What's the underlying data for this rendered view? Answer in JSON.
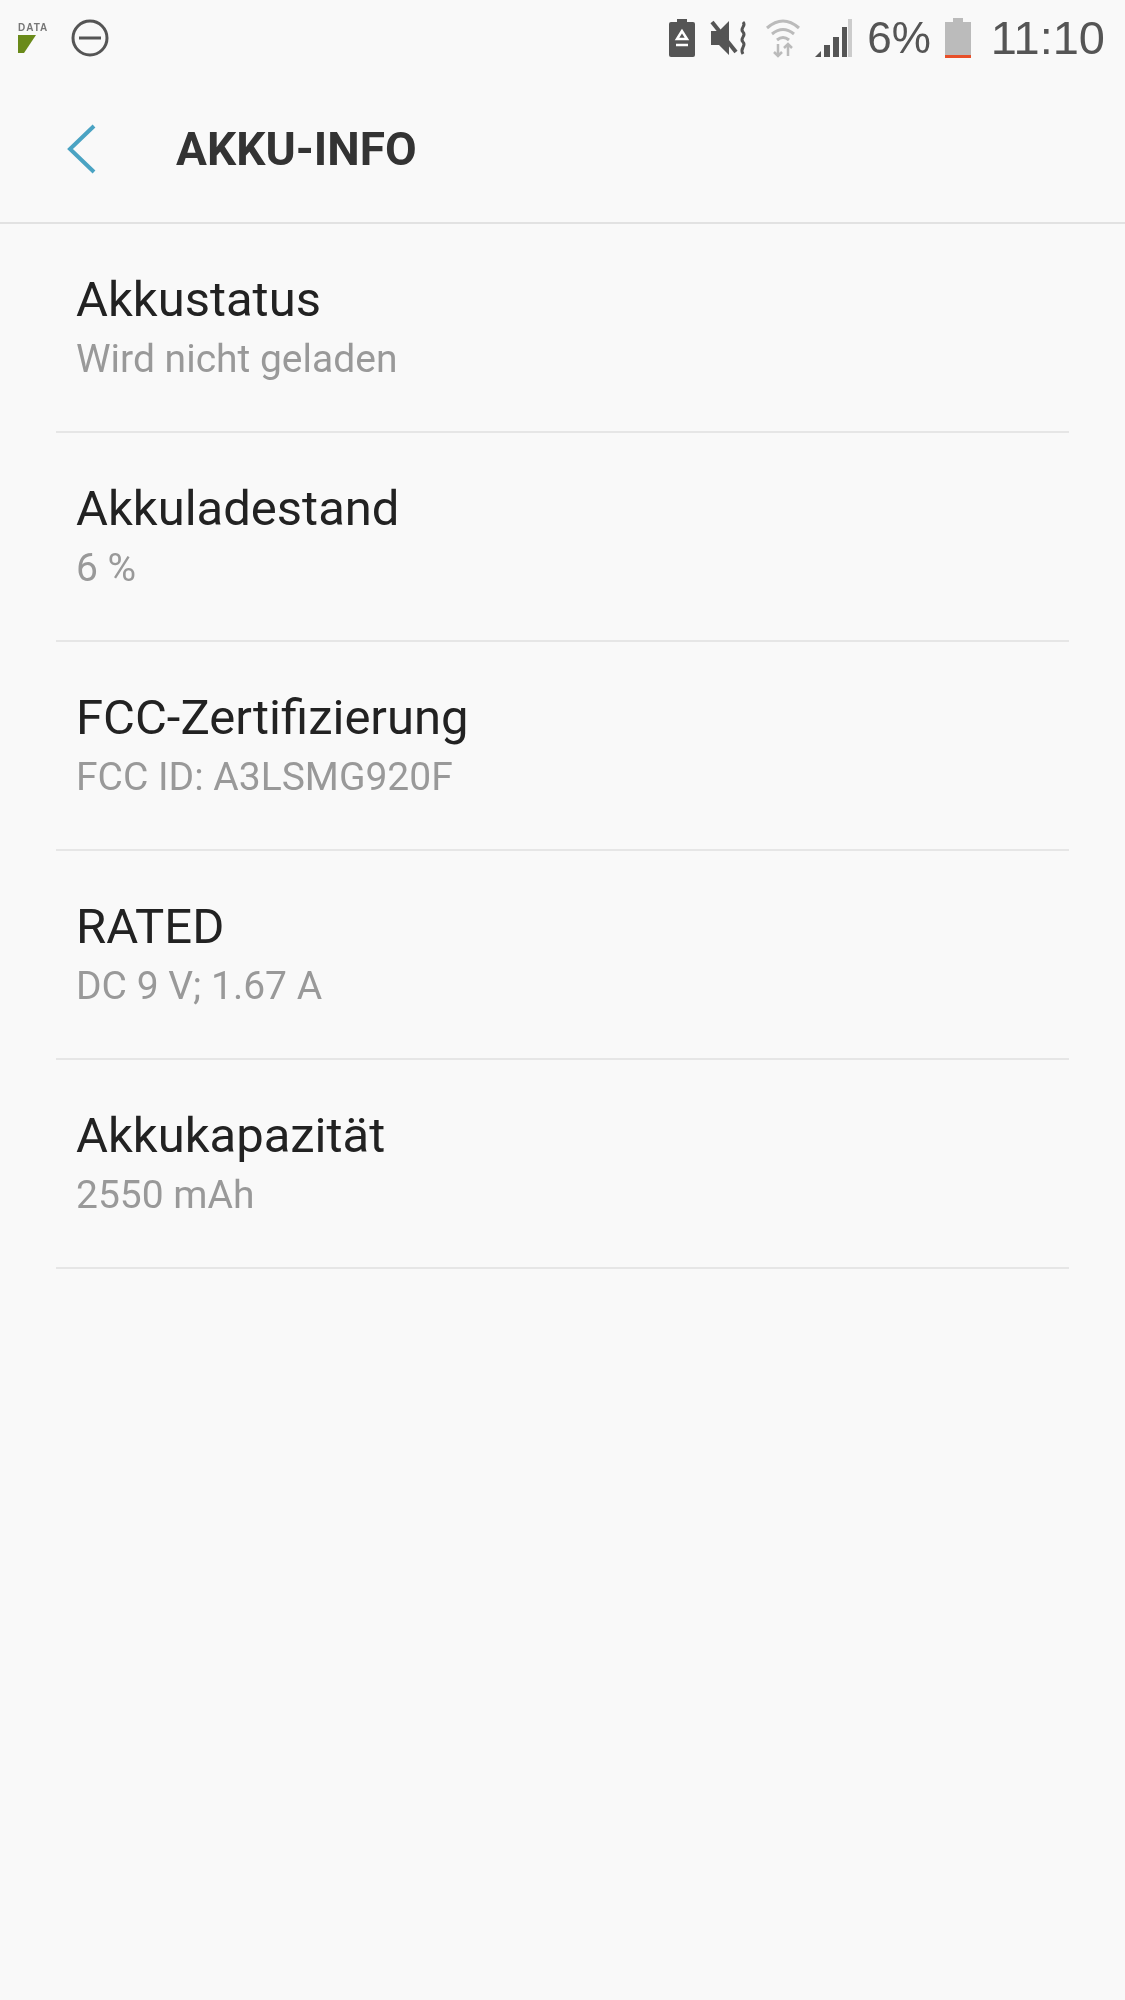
{
  "status_bar": {
    "data_label": "DATA",
    "battery_percent": "6%",
    "time": "11:10"
  },
  "header": {
    "title": "AKKU-INFO"
  },
  "items": [
    {
      "title": "Akkustatus",
      "value": "Wird nicht geladen"
    },
    {
      "title": "Akkuladestand",
      "value": "6 %"
    },
    {
      "title": "FCC-Zertifizierung",
      "value": "FCC ID: A3LSMG920F"
    },
    {
      "title": "RATED",
      "value": "DC 9 V; 1.67 A"
    },
    {
      "title": "Akkukapazität",
      "value": "2550 mAh"
    }
  ]
}
